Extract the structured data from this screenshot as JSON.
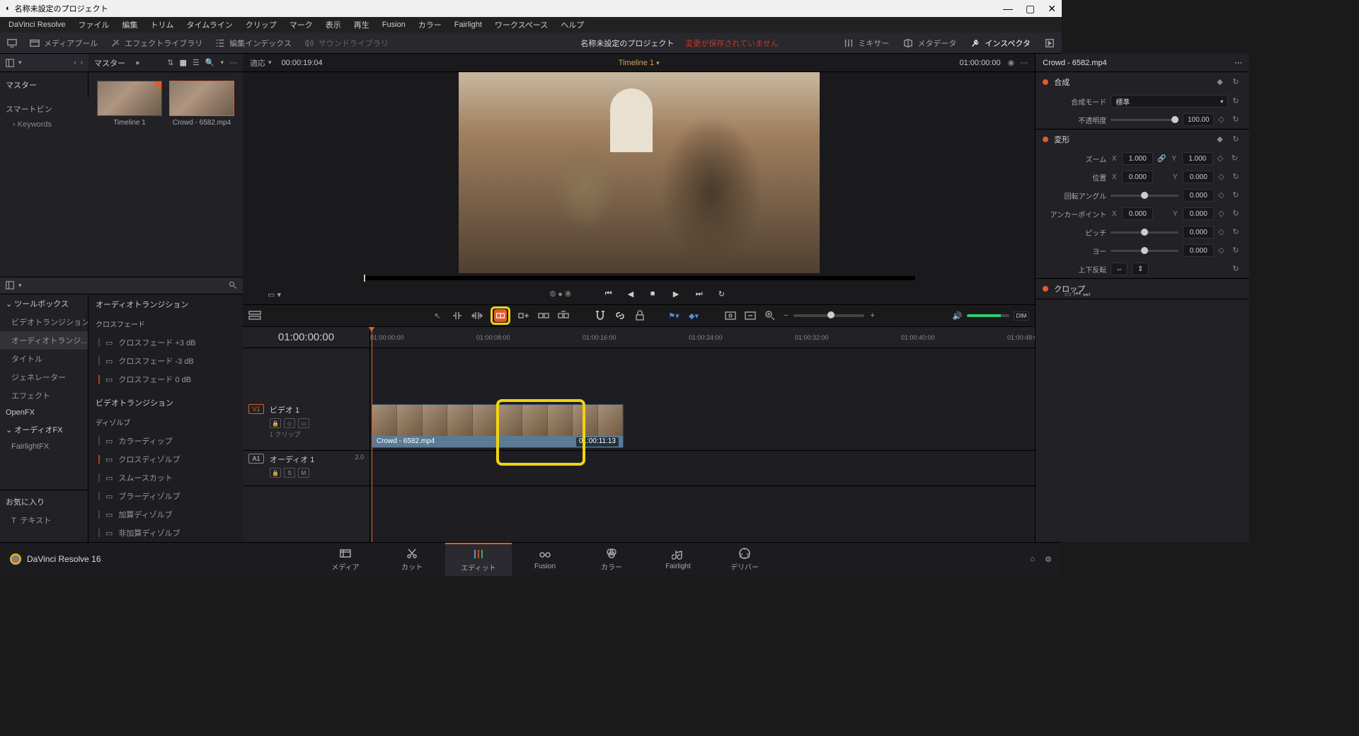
{
  "window": {
    "title": "名称未設定のプロジェクト"
  },
  "menu": [
    "DaVinci Resolve",
    "ファイル",
    "編集",
    "トリム",
    "タイムライン",
    "クリップ",
    "マーク",
    "表示",
    "再生",
    "Fusion",
    "カラー",
    "Fairlight",
    "ワークスペース",
    "ヘルプ"
  ],
  "toolbar": {
    "mediapool": "メディアプール",
    "fxlib": "エフェクトライブラリ",
    "editidx": "編集インデックス",
    "sndlib": "サウンドライブラリ",
    "mixer": "ミキサー",
    "metadata": "メタデータ",
    "inspector": "インスペクタ"
  },
  "project": {
    "name": "名称未設定のプロジェクト",
    "warn": "変更が保存されていません"
  },
  "mediapool": {
    "master": "マスター",
    "nav": "マスター",
    "smartbin": "スマートビン",
    "keywords": "Keywords",
    "thumbs": [
      {
        "label": "Timeline 1"
      },
      {
        "label": "Crowd - 6582.mp4"
      }
    ]
  },
  "fx": {
    "tree": [
      {
        "label": "ツールボックス",
        "lvl": 0
      },
      {
        "label": "ビデオトランジション",
        "lvl": 1
      },
      {
        "label": "オーディオトランジ...",
        "lvl": 1,
        "sel": true
      },
      {
        "label": "タイトル",
        "lvl": 1
      },
      {
        "label": "ジェネレーター",
        "lvl": 1
      },
      {
        "label": "エフェクト",
        "lvl": 1
      },
      {
        "label": "OpenFX",
        "lvl": 0
      },
      {
        "label": "オーディオFX",
        "lvl": 0
      },
      {
        "label": "FairlightFX",
        "lvl": 1
      }
    ],
    "fav": "お気に入り",
    "favitem": "テキスト",
    "list": {
      "grp1": "オーディオトランジション",
      "sub1": "クロスフェード",
      "items1": [
        "クロスフェード +3 dB",
        "クロスフェード -3 dB",
        "クロスフェード 0 dB"
      ],
      "grp2": "ビデオトランジション",
      "sub2": "ディゾルブ",
      "items2": [
        "カラーディップ",
        "クロスディゾルブ",
        "スムースカット",
        "ブラーディゾルブ",
        "加算ディゾルブ",
        "非加算ディゾルブ"
      ]
    }
  },
  "viewer": {
    "fit": "適応",
    "duration": "00:00:19:04",
    "timeline_name": "Timeline 1",
    "tc": "01:00:00:00"
  },
  "timeline": {
    "tc": "01:00:00:00",
    "ticks": [
      "01:00:00:00",
      "01:00:08:00",
      "01:00:16:00",
      "01:00:24:00",
      "01:00:32:00",
      "01:00:40:00",
      "01:00:48:0"
    ],
    "v1": {
      "badge": "V1",
      "name": "ビデオ 1",
      "meta": "1 クリップ"
    },
    "a1": {
      "badge": "A1",
      "name": "オーディオ 1",
      "ch": "2.0",
      "s": "S",
      "m": "M"
    },
    "clip": {
      "name": "Crowd - 6582.mp4",
      "tc": "01:00:11:13"
    }
  },
  "inspector": {
    "clip": "Crowd - 6582.mp4",
    "composite": {
      "title": "合成",
      "mode_lbl": "合成モード",
      "mode": "標準",
      "opacity_lbl": "不透明度",
      "opacity": "100.00"
    },
    "transform": {
      "title": "変形",
      "zoom_lbl": "ズーム",
      "zx": "1.000",
      "zy": "1.000",
      "pos_lbl": "位置",
      "px": "0.000",
      "py": "0.000",
      "rot_lbl": "回転アングル",
      "rot": "0.000",
      "anchor_lbl": "アンカーポイント",
      "ax": "0.000",
      "ay": "0.000",
      "pitch_lbl": "ピッチ",
      "pitch": "0.000",
      "yaw_lbl": "ヨー",
      "yaw": "0.000",
      "flip_lbl": "上下反転"
    },
    "crop": {
      "title": "クロップ"
    }
  },
  "pages": {
    "app": "DaVinci Resolve 16",
    "items": [
      "メディア",
      "カット",
      "エディット",
      "Fusion",
      "カラー",
      "Fairlight",
      "デリバー"
    ],
    "dim": "DIM"
  }
}
